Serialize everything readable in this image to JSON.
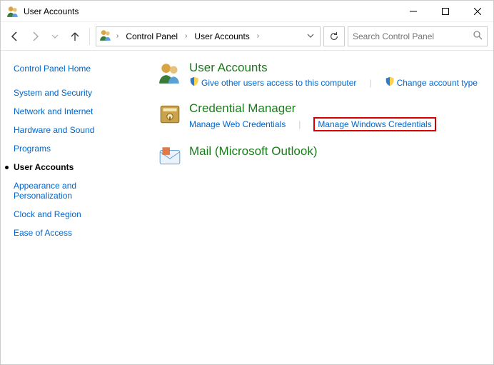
{
  "window": {
    "title": "User Accounts"
  },
  "breadcrumb": {
    "root": "Control Panel",
    "current": "User Accounts"
  },
  "search": {
    "placeholder": "Search Control Panel"
  },
  "sidebar": {
    "home": "Control Panel Home",
    "items": [
      "System and Security",
      "Network and Internet",
      "Hardware and Sound",
      "Programs",
      "User Accounts",
      "Appearance and Personalization",
      "Clock and Region",
      "Ease of Access"
    ],
    "activeIndex": 4
  },
  "categories": {
    "userAccounts": {
      "title": "User Accounts",
      "task_give_access": "Give other users access to this computer",
      "task_change_type": "Change account type"
    },
    "credentialManager": {
      "title": "Credential Manager",
      "task_web": "Manage Web Credentials",
      "task_windows": "Manage Windows Credentials"
    },
    "mail": {
      "title": "Mail (Microsoft Outlook)"
    }
  }
}
